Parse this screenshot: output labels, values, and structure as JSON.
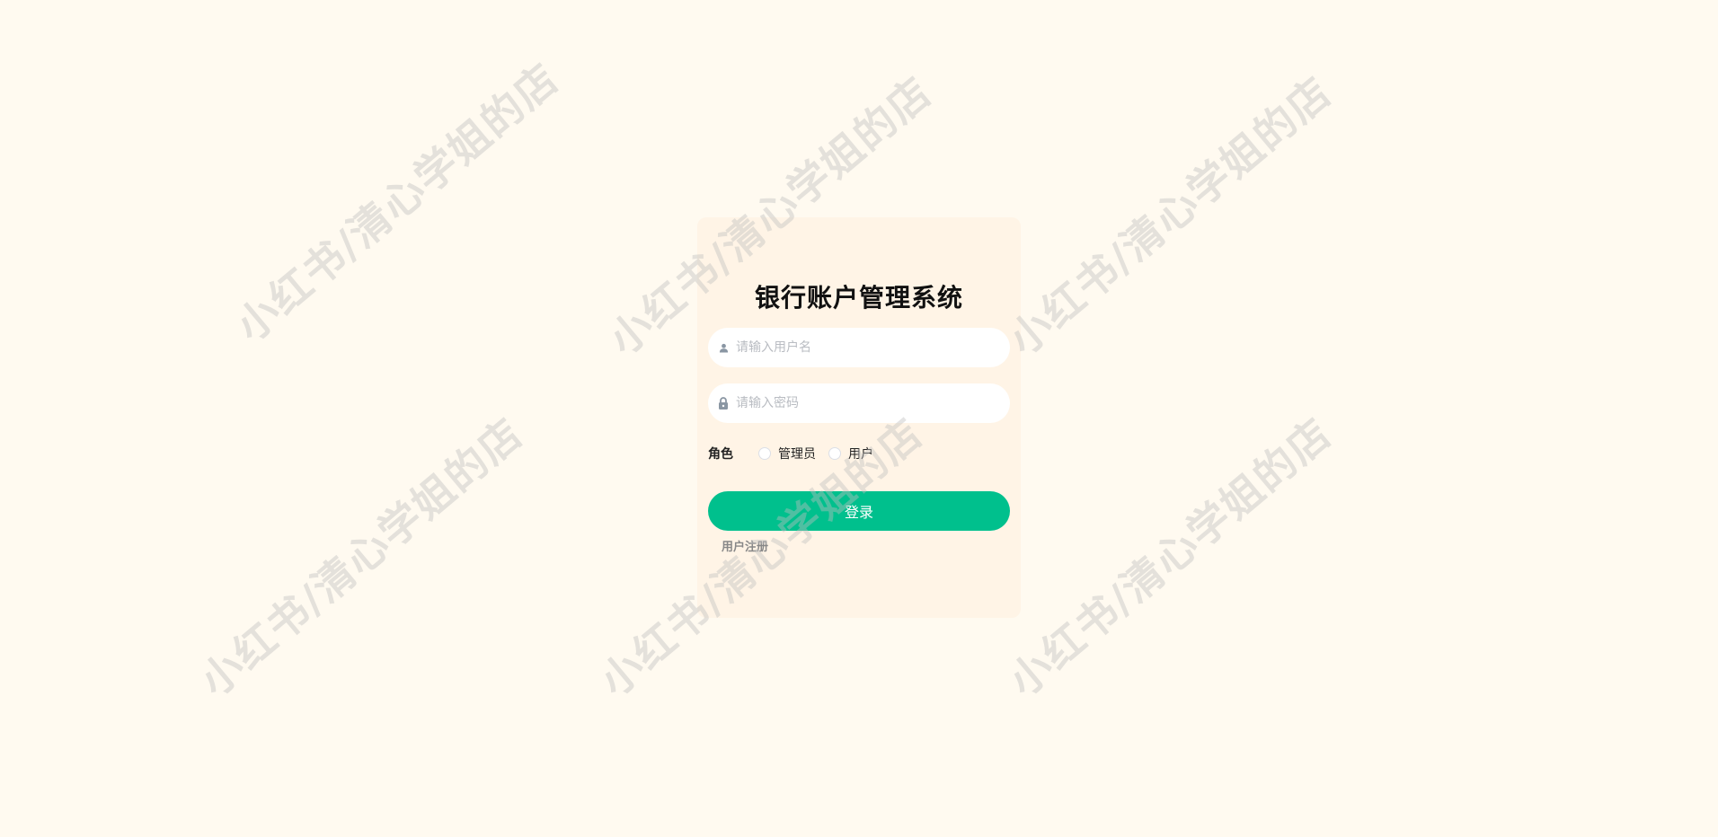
{
  "login": {
    "title": "银行账户管理系统",
    "username_placeholder": "请输入用户名",
    "password_placeholder": "请输入密码",
    "role_label": "角色",
    "role_options": [
      "管理员",
      "用户"
    ],
    "login_button": "登录",
    "register_link": "用户注册"
  },
  "watermark": "小红书/清心学姐的店",
  "colors": {
    "background": "#fffaf0",
    "card": "#fff4e6",
    "accent": "#00c08d"
  },
  "icons": {
    "username": "user-icon",
    "password": "lock-icon"
  }
}
